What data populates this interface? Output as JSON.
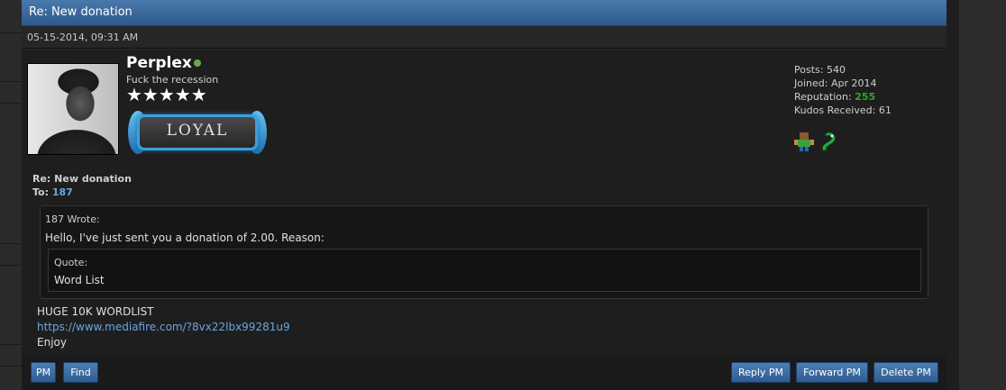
{
  "header": {
    "title": "Re: New donation"
  },
  "post": {
    "date": "05-15-2014, 09:31 AM",
    "user": {
      "username": "Perplex",
      "title": "Fuck the recession",
      "stars": "★★★★★",
      "badge_text": "LOYAL",
      "stats": {
        "posts_label": "Posts:",
        "posts": "540",
        "joined_label": "Joined:",
        "joined": "Apr 2014",
        "reputation_label": "Reputation:",
        "reputation": "255",
        "kudos_label": "Kudos Received:",
        "kudos": "61"
      }
    },
    "message": {
      "title": "Re: New donation",
      "to_label": "To:",
      "to_user": "187",
      "quote": {
        "author": "187 Wrote:",
        "text": "Hello, I've just sent you a donation of 2.00. Reason:",
        "inner_label": "Quote:",
        "inner_text": "Word List"
      },
      "body": {
        "line1": "HUGE 10K WORDLIST",
        "link": "https://www.mediafire.com/?8vx22lbx99281u9",
        "line3": "Enjoy"
      }
    }
  },
  "buttons": {
    "pm": "PM",
    "find": "Find",
    "reply_pm": "Reply PM",
    "forward_pm": "Forward PM",
    "delete_pm": "Delete PM"
  },
  "colors": {
    "header_blue": "#3a6a9e",
    "reputation_green": "#2ea52e",
    "link_blue": "#6aa6e0",
    "online_green": "#6aa84f"
  }
}
